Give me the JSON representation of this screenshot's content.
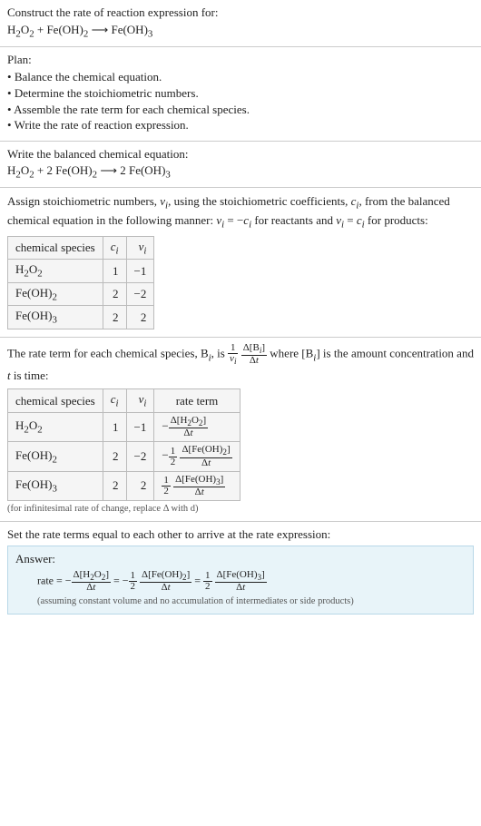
{
  "header": {
    "prompt": "Construct the rate of reaction expression for:",
    "equation_html": "H<sub>2</sub>O<sub>2</sub> + Fe(OH)<sub>2</sub>  ⟶  Fe(OH)<sub>3</sub>"
  },
  "plan": {
    "title": "Plan:",
    "items": [
      "Balance the chemical equation.",
      "Determine the stoichiometric numbers.",
      "Assemble the rate term for each chemical species.",
      "Write the rate of reaction expression."
    ]
  },
  "balanced": {
    "intro": "Write the balanced chemical equation:",
    "equation_html": "H<sub>2</sub>O<sub>2</sub> + 2 Fe(OH)<sub>2</sub>  ⟶  2 Fe(OH)<sub>3</sub>"
  },
  "stoich_intro_html": "Assign stoichiometric numbers, <span class=\"it\">ν<sub>i</sub></span>, using the stoichiometric coefficients, <span class=\"it\">c<sub>i</sub></span>, from the balanced chemical equation in the following manner: <span class=\"it\">ν<sub>i</sub></span> = −<span class=\"it\">c<sub>i</sub></span> for reactants and <span class=\"it\">ν<sub>i</sub></span> = <span class=\"it\">c<sub>i</sub></span> for products:",
  "stoich_table": {
    "headers": [
      "chemical species",
      "c_i",
      "ν_i"
    ],
    "rows": [
      {
        "species_html": "H<sub>2</sub>O<sub>2</sub>",
        "c": "1",
        "v": "−1"
      },
      {
        "species_html": "Fe(OH)<sub>2</sub>",
        "c": "2",
        "v": "−2"
      },
      {
        "species_html": "Fe(OH)<sub>3</sub>",
        "c": "2",
        "v": "2"
      }
    ]
  },
  "rate_intro_html": "The rate term for each chemical species, B<sub><span class=\"it\">i</span></sub>, is <span class=\"frac\"><span class=\"num\">1</span><span class=\"den\"><span class=\"it\">ν<sub>i</sub></span></span></span> <span class=\"frac\"><span class=\"num\">Δ[B<sub><span class=\"it\">i</span></sub>]</span><span class=\"den\">Δ<span class=\"it\">t</span></span></span> where [B<sub><span class=\"it\">i</span></sub>] is the amount concentration and <span class=\"it\">t</span> is time:",
  "rate_table": {
    "headers": [
      "chemical species",
      "c_i",
      "ν_i",
      "rate term"
    ],
    "rows": [
      {
        "species_html": "H<sub>2</sub>O<sub>2</sub>",
        "c": "1",
        "v": "−1",
        "rate_html": "−<span class=\"frac\"><span class=\"num\">Δ[H<sub>2</sub>O<sub>2</sub>]</span><span class=\"den\">Δ<span class=\"it\">t</span></span></span>"
      },
      {
        "species_html": "Fe(OH)<sub>2</sub>",
        "c": "2",
        "v": "−2",
        "rate_html": "−<span class=\"frac\"><span class=\"num\">1</span><span class=\"den\">2</span></span> <span class=\"frac\"><span class=\"num\">Δ[Fe(OH)<sub>2</sub>]</span><span class=\"den\">Δ<span class=\"it\">t</span></span></span>"
      },
      {
        "species_html": "Fe(OH)<sub>3</sub>",
        "c": "2",
        "v": "2",
        "rate_html": "<span class=\"frac\"><span class=\"num\">1</span><span class=\"den\">2</span></span> <span class=\"frac\"><span class=\"num\">Δ[Fe(OH)<sub>3</sub>]</span><span class=\"den\">Δ<span class=\"it\">t</span></span></span>"
      }
    ]
  },
  "rate_note": "(for infinitesimal rate of change, replace Δ with d)",
  "final_intro": "Set the rate terms equal to each other to arrive at the rate expression:",
  "answer": {
    "title": "Answer:",
    "rate_html": "rate = −<span class=\"frac\"><span class=\"num\">Δ[H<sub>2</sub>O<sub>2</sub>]</span><span class=\"den\">Δ<span class=\"it\">t</span></span></span> = −<span class=\"frac\"><span class=\"num\">1</span><span class=\"den\">2</span></span> <span class=\"frac\"><span class=\"num\">Δ[Fe(OH)<sub>2</sub>]</span><span class=\"den\">Δ<span class=\"it\">t</span></span></span> = <span class=\"frac\"><span class=\"num\">1</span><span class=\"den\">2</span></span> <span class=\"frac\"><span class=\"num\">Δ[Fe(OH)<sub>3</sub>]</span><span class=\"den\">Δ<span class=\"it\">t</span></span></span>",
    "assumption": "(assuming constant volume and no accumulation of intermediates or side products)"
  },
  "chart_data": {
    "type": "table",
    "tables": [
      {
        "columns": [
          "chemical species",
          "c_i",
          "ν_i"
        ],
        "rows": [
          [
            "H2O2",
            1,
            -1
          ],
          [
            "Fe(OH)2",
            2,
            -2
          ],
          [
            "Fe(OH)3",
            2,
            2
          ]
        ]
      },
      {
        "columns": [
          "chemical species",
          "c_i",
          "ν_i",
          "rate term"
        ],
        "rows": [
          [
            "H2O2",
            1,
            -1,
            "-Δ[H2O2]/Δt"
          ],
          [
            "Fe(OH)2",
            2,
            -2,
            "-(1/2) Δ[Fe(OH)2]/Δt"
          ],
          [
            "Fe(OH)3",
            2,
            2,
            "(1/2) Δ[Fe(OH)3]/Δt"
          ]
        ]
      }
    ]
  }
}
